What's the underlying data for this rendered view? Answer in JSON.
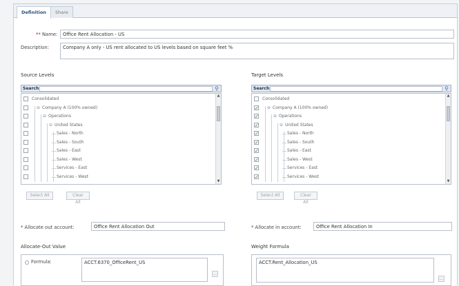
{
  "tabs": [
    {
      "label": "Definition",
      "active": true
    },
    {
      "label": "Share",
      "active": false
    }
  ],
  "form": {
    "name_label": "* Name:",
    "name_value": "Office Rent Allocation - US",
    "description_label": "Description:",
    "description_value": "Company A only - US rent allocated to US levels based on square feet %"
  },
  "source": {
    "title": "Source Levels",
    "search_label": "Search:",
    "search_placeholder": "",
    "items": [
      {
        "label": "Consolidated",
        "checked": false
      },
      {
        "label": "Company A (100% owned)",
        "checked": false
      },
      {
        "label": "Operations",
        "checked": false
      },
      {
        "label": "United States",
        "checked": false
      },
      {
        "label": "Sales - North",
        "checked": false
      },
      {
        "label": "Sales - South",
        "checked": false
      },
      {
        "label": "Sales - East",
        "checked": false
      },
      {
        "label": "Sales - West",
        "checked": false
      },
      {
        "label": "Services - East",
        "checked": false
      },
      {
        "label": "Services - West",
        "checked": false
      }
    ],
    "select_all": "Select All",
    "clear_all": "Clear All"
  },
  "target": {
    "title": "Target Levels",
    "search_label": "Search:",
    "search_placeholder": "",
    "items": [
      {
        "label": "Consolidated",
        "checked": false
      },
      {
        "label": "Company A (100% owned)",
        "checked": true
      },
      {
        "label": "Operations",
        "checked": true
      },
      {
        "label": "United States",
        "checked": true
      },
      {
        "label": "Sales - North",
        "checked": true
      },
      {
        "label": "Sales - South",
        "checked": true
      },
      {
        "label": "Sales - East",
        "checked": true
      },
      {
        "label": "Sales - West",
        "checked": true
      },
      {
        "label": "Services - East",
        "checked": true
      },
      {
        "label": "Services - West",
        "checked": true
      }
    ],
    "select_all": "Select All",
    "clear_all": "Clear All"
  },
  "allocate_out": {
    "label": "* Allocate out account:",
    "value": "Office Rent Allocation Out"
  },
  "allocate_in": {
    "label": "* Allocate in account:",
    "value": "Office Rent Allocation In"
  },
  "allocate_out_value": {
    "title": "Allocate-Out Value",
    "formula_label": "Formula:",
    "formula_value": "ACCT.6370_OfficeRent_US"
  },
  "weight_formula": {
    "title": "Weight Formula",
    "value": "ACCT.Rent_Allocation_US"
  }
}
